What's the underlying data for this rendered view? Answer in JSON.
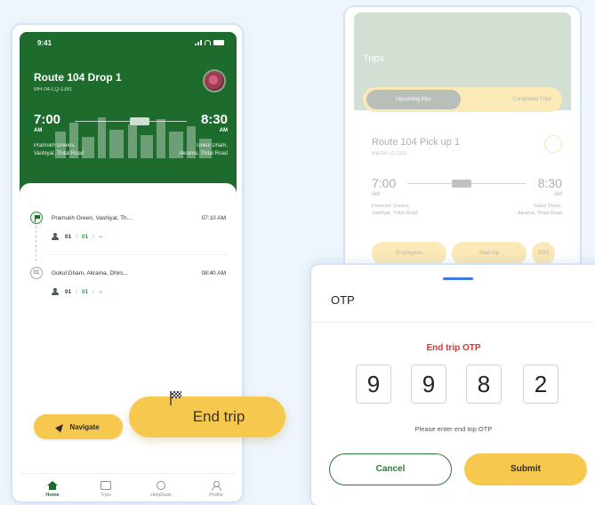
{
  "left_screen": {
    "status_time": "9:41",
    "route_title": "Route 104 Drop 1",
    "route_id": "MH-04-LQ-1391",
    "start_time": "7:00",
    "start_ampm": "AM",
    "end_time": "8:30",
    "end_ampm": "AM",
    "start_location_line1": "Pramukh Greens,",
    "start_location_line2": "Vashiyal, Thital Road",
    "end_location_line1": "Gokul Dham,",
    "end_location_line2": "Akrama, Thital Road",
    "stops": [
      {
        "address": "Pramukh Green, Vashiyal, Th...",
        "time": "07:10 AM",
        "icon": "flag-icon",
        "total": "01",
        "separator": "/",
        "boarded": "01",
        "missed": "--"
      },
      {
        "address": "Gokul Dham, Akrama, Dhirs...",
        "time": "08:40 AM",
        "icon": "stop-number",
        "stop_no": "01",
        "total": "01",
        "separator": "/",
        "boarded": "01",
        "missed": "--"
      }
    ],
    "navigate_label": "Navigate",
    "tabs": [
      {
        "label": "Home",
        "icon": "home-icon",
        "active": true
      },
      {
        "label": "Trips",
        "icon": "trips-icon",
        "active": false
      },
      {
        "label": "HelpDesk",
        "icon": "help-icon",
        "active": false
      },
      {
        "label": "Profile",
        "icon": "profile-icon",
        "active": false
      }
    ]
  },
  "end_trip_button": {
    "label": "End trip",
    "icon": "checkered-flag-icon"
  },
  "right_screen": {
    "title": "Trips",
    "segment_active": "Upcoming trips",
    "segment_other": "Completed Trips",
    "card_title": "Route 104 Pick up 1",
    "card_sub": "MH-04-LQ-1391",
    "start_time": "7:00",
    "start_ampm": "AM",
    "end_time": "8:30",
    "end_ampm": "AM",
    "start_location_line1": "Pramukh Greens,",
    "start_location_line2": "Vashiyal, Thital Road",
    "end_location_line1": "Gokul Dham,",
    "end_location_line2": "Akrama, Thital Road",
    "employees_label": "Employees",
    "start_trip_label": "Start trip",
    "more_label": "SOS"
  },
  "otp_sheet": {
    "title": "OTP",
    "label": "End trip OTP",
    "digits": [
      "9",
      "9",
      "8",
      "2"
    ],
    "hint": "Please enter end trip OTP",
    "cancel_label": "Cancel",
    "submit_label": "Submit"
  },
  "colors": {
    "brand_green": "#1e6b2e",
    "accent_yellow": "#f6c84d",
    "alert_red": "#e03030",
    "background": "#eef5fc"
  }
}
